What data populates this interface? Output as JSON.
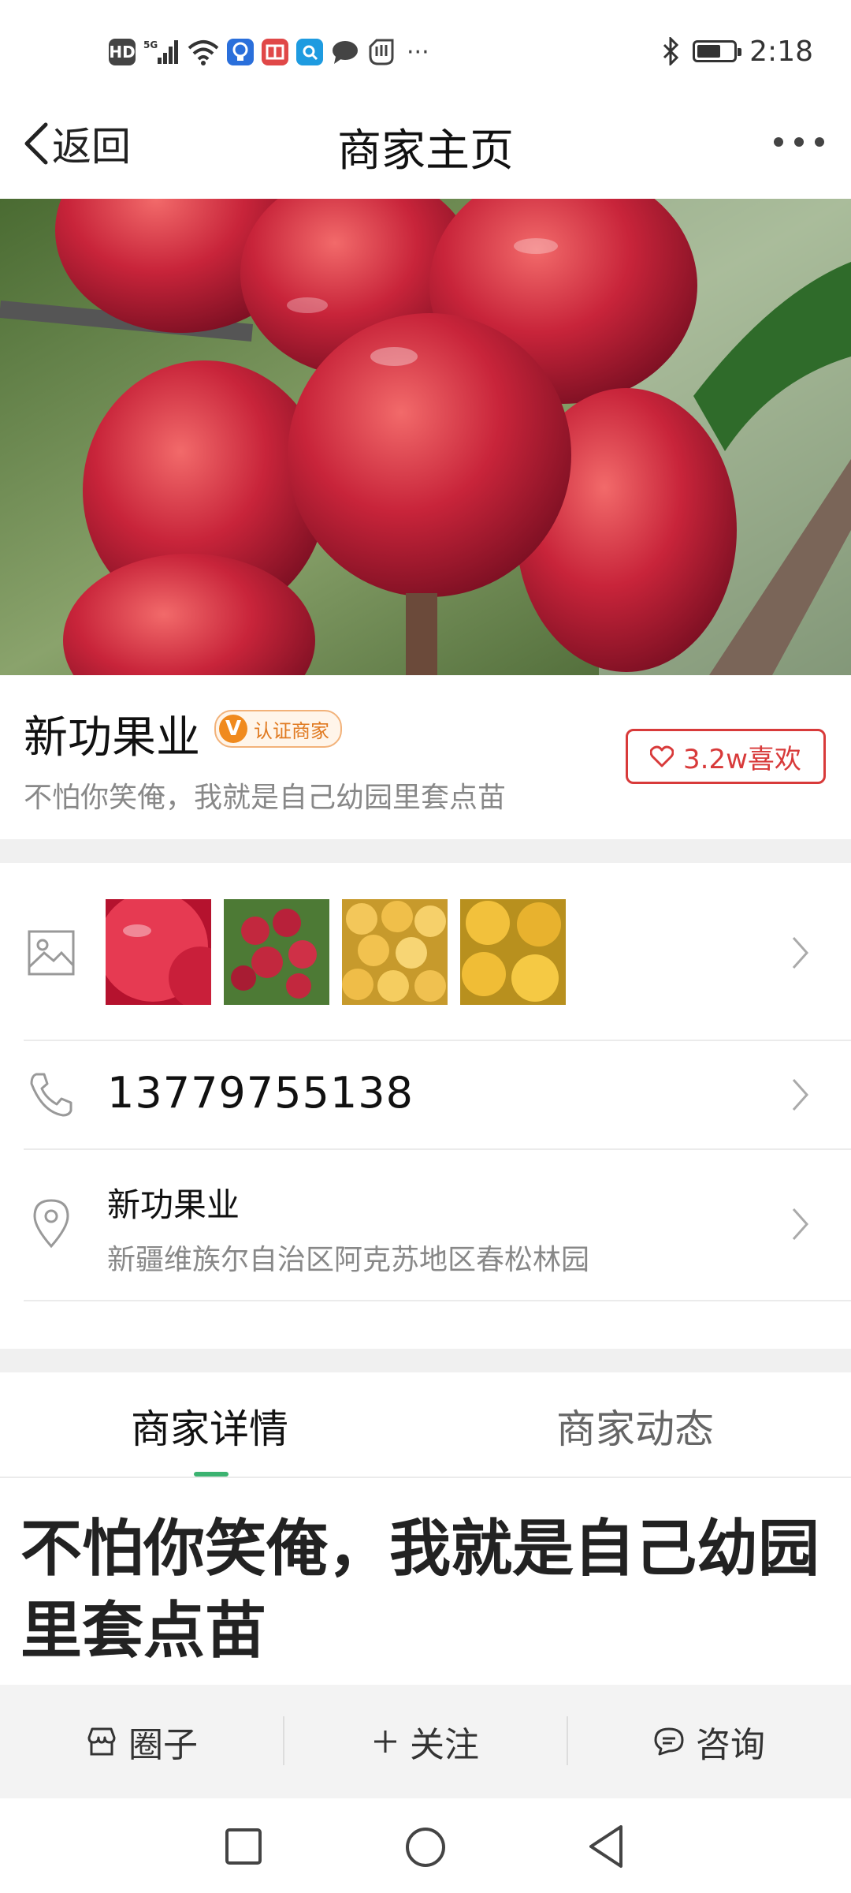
{
  "status_bar": {
    "time": "2:18",
    "left_icons": [
      "hd-icon",
      "5g-signal-icon",
      "wifi-icon",
      "app-notification-icon",
      "app-notification-icon",
      "app-notification-icon",
      "chat-icon",
      "hand-icon",
      "more-dots-icon"
    ],
    "right_icons": [
      "bluetooth-icon",
      "battery-icon"
    ],
    "hd_label": "HD",
    "net_label": "5G",
    "overflow": "···"
  },
  "nav": {
    "back_label": "返回",
    "title": "商家主页"
  },
  "merchant": {
    "name": "新功果业",
    "badge_letter": "V",
    "badge_label": "认证商家",
    "slogan": "不怕你笑俺，我就是自己幼园里套点苗",
    "like_label": "3.2w喜欢"
  },
  "gallery": {
    "icon": "image-icon",
    "thumbnails": [
      "red-plum-closeup",
      "red-plums-on-branch",
      "yellow-apricots-pile",
      "yellow-apricots-closeup"
    ]
  },
  "contact": {
    "phone": "13779755138"
  },
  "location": {
    "name": "新功果业",
    "address": "新疆维族尔自治区阿克苏地区春松林园"
  },
  "tabs": {
    "active": "商家详情",
    "inactive": "商家动态"
  },
  "article": {
    "title": "不怕你笑俺，我就是自己幼园里套点苗"
  },
  "actions": {
    "circle": "圈子",
    "follow": "关注",
    "consult": "咨询"
  },
  "colors": {
    "accent_green": "#3cb371",
    "like_red": "#d83a3a",
    "badge_orange": "#f08a1e"
  }
}
